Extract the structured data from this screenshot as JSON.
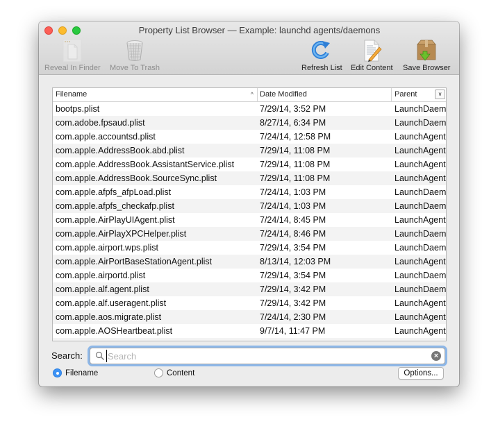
{
  "window": {
    "title": "Property List Browser — Example: launchd agents/daemons"
  },
  "toolbar": {
    "reveal_in_finder": "Reveal In Finder",
    "move_to_trash": "Move To Trash",
    "refresh_list": "Refresh List",
    "edit_content": "Edit Content",
    "save_browser": "Save Browser"
  },
  "table": {
    "columns": {
      "filename": "Filename",
      "date_modified": "Date Modified",
      "parent": "Parent"
    },
    "sort_indicator": "^",
    "column_menu_glyph": "⌄",
    "rows": [
      {
        "filename": "bootps.plist",
        "date": "7/29/14, 3:52 PM",
        "parent": "LaunchDaemons"
      },
      {
        "filename": "com.adobe.fpsaud.plist",
        "date": "8/27/14, 6:34 PM",
        "parent": "LaunchDaemons"
      },
      {
        "filename": "com.apple.accountsd.plist",
        "date": "7/24/14, 12:58 PM",
        "parent": "LaunchAgents"
      },
      {
        "filename": "com.apple.AddressBook.abd.plist",
        "date": "7/29/14, 11:08 PM",
        "parent": "LaunchAgents"
      },
      {
        "filename": "com.apple.AddressBook.AssistantService.plist",
        "date": "7/29/14, 11:08 PM",
        "parent": "LaunchAgents"
      },
      {
        "filename": "com.apple.AddressBook.SourceSync.plist",
        "date": "7/29/14, 11:08 PM",
        "parent": "LaunchAgents"
      },
      {
        "filename": "com.apple.afpfs_afpLoad.plist",
        "date": "7/24/14, 1:03 PM",
        "parent": "LaunchDaemons"
      },
      {
        "filename": "com.apple.afpfs_checkafp.plist",
        "date": "7/24/14, 1:03 PM",
        "parent": "LaunchDaemons"
      },
      {
        "filename": "com.apple.AirPlayUIAgent.plist",
        "date": "7/24/14, 8:45 PM",
        "parent": "LaunchAgents"
      },
      {
        "filename": "com.apple.AirPlayXPCHelper.plist",
        "date": "7/24/14, 8:46 PM",
        "parent": "LaunchDaemons"
      },
      {
        "filename": "com.apple.airport.wps.plist",
        "date": "7/29/14, 3:54 PM",
        "parent": "LaunchDaemons"
      },
      {
        "filename": "com.apple.AirPortBaseStationAgent.plist",
        "date": "8/13/14, 12:03 PM",
        "parent": "LaunchAgents"
      },
      {
        "filename": "com.apple.airportd.plist",
        "date": "7/29/14, 3:54 PM",
        "parent": "LaunchDaemons"
      },
      {
        "filename": "com.apple.alf.agent.plist",
        "date": "7/29/14, 3:42 PM",
        "parent": "LaunchDaemons"
      },
      {
        "filename": "com.apple.alf.useragent.plist",
        "date": "7/29/14, 3:42 PM",
        "parent": "LaunchAgents"
      },
      {
        "filename": "com.apple.aos.migrate.plist",
        "date": "7/24/14, 2:30 PM",
        "parent": "LaunchAgents"
      },
      {
        "filename": "com.apple.AOSHeartbeat.plist",
        "date": "9/7/14, 11:47 PM",
        "parent": "LaunchAgents"
      }
    ]
  },
  "search": {
    "label": "Search:",
    "value": "",
    "placeholder": "Search",
    "clear_glyph": "×"
  },
  "scope": {
    "filename_label": "Filename",
    "content_label": "Content",
    "selected": "filename"
  },
  "options_button": "Options...",
  "colors": {
    "accent": "#3d93f5",
    "focus_ring": "#8db7e8",
    "close": "#fc5f57",
    "minimize": "#fdbc2e",
    "zoom": "#29c940"
  }
}
